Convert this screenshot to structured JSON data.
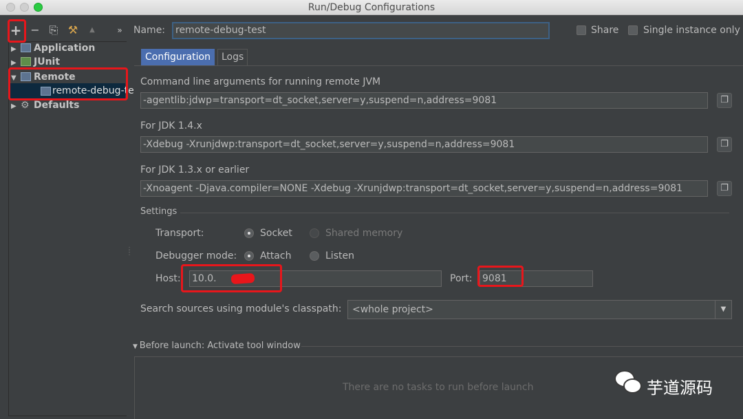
{
  "window": {
    "title": "Run/Debug Configurations"
  },
  "toolbar": {
    "add": "+",
    "remove": "−",
    "copy": "⎘",
    "edit": "⚒",
    "up": "▲",
    "more": "»"
  },
  "tree": {
    "nodes": [
      {
        "label": "Application",
        "icon": "application-icon"
      },
      {
        "label": "JUnit",
        "icon": "junit-icon"
      },
      {
        "label": "Remote",
        "icon": "remote-icon"
      },
      {
        "label": "Defaults",
        "icon": "gear-icon"
      }
    ],
    "selected": "remote-debug-test"
  },
  "header": {
    "name_label": "Name:",
    "name_value": "remote-debug-test",
    "share_label": "Share",
    "single_instance_label": "Single instance only"
  },
  "tabs": [
    {
      "label": "Configuration",
      "active": true
    },
    {
      "label": "Logs",
      "active": false
    }
  ],
  "config": {
    "cmd_label": "Command line arguments for running remote JVM",
    "cmd_value": "-agentlib:jdwp=transport=dt_socket,server=y,suspend=n,address=9081",
    "jdk14_label": "For JDK 1.4.x",
    "jdk14_value": "-Xdebug -Xrunjdwp:transport=dt_socket,server=y,suspend=n,address=9081",
    "jdk13_label": "For JDK 1.3.x or earlier",
    "jdk13_value": "-Xnoagent -Djava.compiler=NONE -Xdebug -Xrunjdwp:transport=dt_socket,server=y,suspend=n,address=9081",
    "settings_label": "Settings",
    "transport_label": "Transport:",
    "transport_socket": "Socket",
    "transport_shared": "Shared memory",
    "debugger_label": "Debugger mode:",
    "debugger_attach": "Attach",
    "debugger_listen": "Listen",
    "host_label": "Host:",
    "host_value": "10.0.",
    "port_label": "Port:",
    "port_value": "9081",
    "search_label": "Search sources using module's classpath:",
    "search_value": "<whole project>"
  },
  "before_launch": {
    "title": "Before launch: Activate tool window",
    "empty_text": "There are no tasks to run before launch"
  },
  "watermark": {
    "text": "芋道源码"
  },
  "colors": {
    "accent": "#4b6eaf",
    "highlight": "#e8161b",
    "selection": "#0d293e"
  }
}
